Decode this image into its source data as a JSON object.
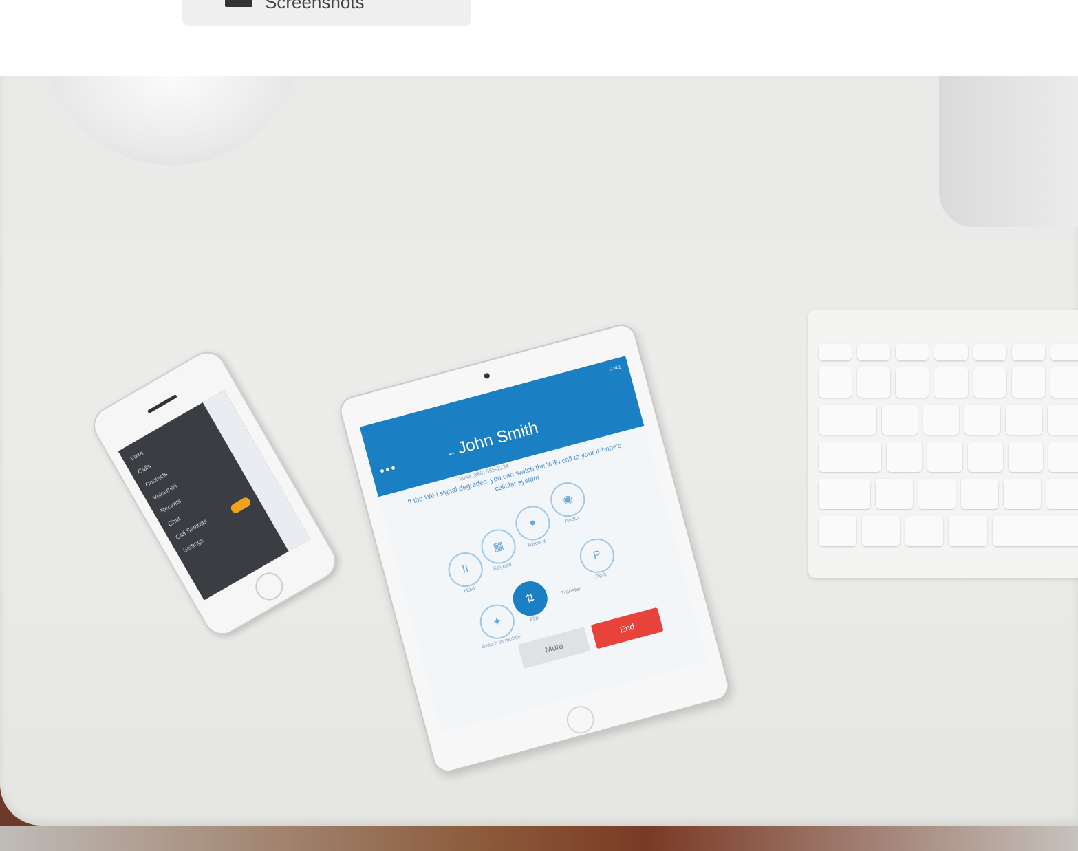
{
  "top_button": {
    "label": "Screenshots"
  },
  "iphone_menu": [
    "Voxa",
    "Calls",
    "Contacts",
    "Voicemail",
    "Recents",
    "Chat",
    "Call Settings",
    "Settings"
  ],
  "ipad": {
    "time": "9:41",
    "dots": "•••",
    "back": "←",
    "title": "John Smith",
    "subinfo": "Voxa (888) 555-1234",
    "notice": "If the WiFi signal degrades, you can switch the WiFi call to your iPhone's cellular system",
    "controls": [
      {
        "label": "Hold",
        "icon": "pause-icon",
        "glyph": "II"
      },
      {
        "label": "Keypad",
        "icon": "keypad-icon",
        "glyph": "▦"
      },
      {
        "label": "Record",
        "icon": "record-icon",
        "glyph": "●"
      },
      {
        "label": "Audio",
        "icon": "speaker-icon",
        "glyph": "◉"
      },
      {
        "label": "Park",
        "icon": "park-icon",
        "glyph": "P"
      },
      {
        "label": "Switch to mobile",
        "icon": "switch-icon",
        "glyph": "✦"
      },
      {
        "label": "Flip",
        "icon": "flip-icon",
        "glyph": "⇅"
      },
      {
        "label": "Transfer",
        "icon": "transfer-icon",
        "glyph": ""
      }
    ],
    "end_label": "End",
    "mute_label": "Mute"
  },
  "colors": {
    "accent": "#1b7fc4",
    "end": "#e8433a",
    "toggle": "#f2a21a"
  }
}
